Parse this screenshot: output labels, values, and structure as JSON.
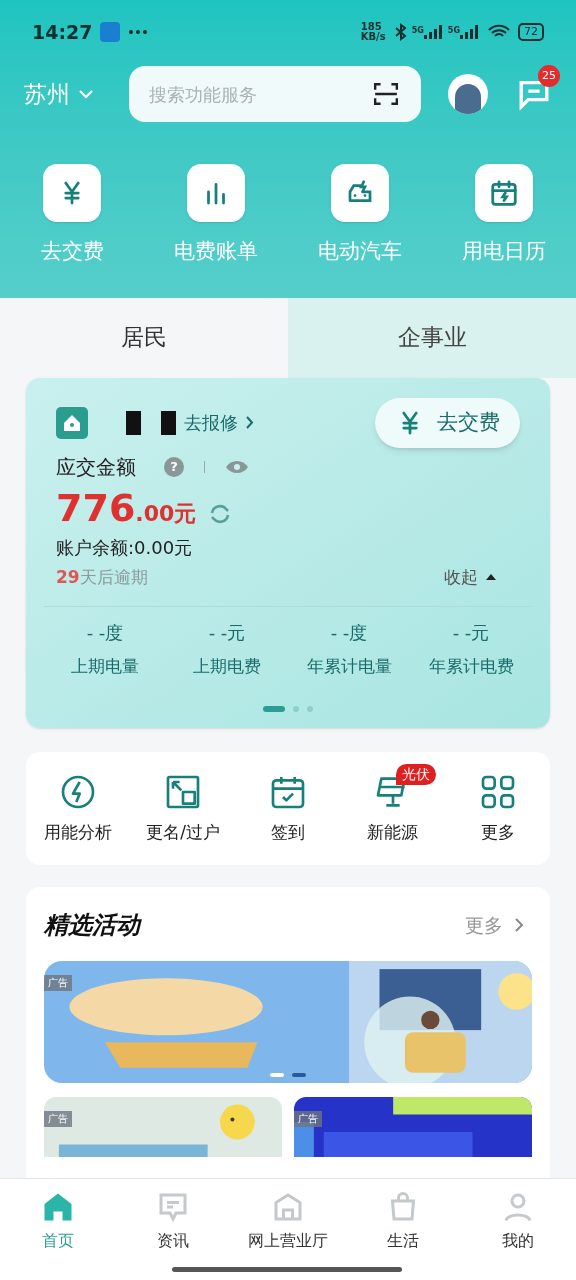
{
  "status_bar": {
    "time": "14:27",
    "speed": "185\nKB/s",
    "battery": "72",
    "network": [
      "5G",
      "5G"
    ]
  },
  "header": {
    "city": "苏州",
    "search": {
      "placeholder": "搜索功能服务"
    },
    "messages_badge": "25"
  },
  "quick_actions": [
    {
      "kind": "yuan",
      "label": "去交费"
    },
    {
      "kind": "bars",
      "label": "电费账单"
    },
    {
      "kind": "car",
      "label": "电动汽车"
    },
    {
      "kind": "calendar",
      "label": "用电日历"
    }
  ],
  "tabs": [
    {
      "label": "居民",
      "selected": true
    },
    {
      "label": "企事业",
      "selected": false
    }
  ],
  "account": {
    "repair_link": "去报修",
    "pay_button": "去交费",
    "amount_label": "应交金额",
    "help": "?",
    "amount_integer": "776",
    "amount_decimal": ".00元",
    "balance": "账户余额:0.00元",
    "due_days": "29",
    "due_text": "天后逾期",
    "collapse": "收起",
    "stats": [
      {
        "value": "- -度",
        "label": "上期电量"
      },
      {
        "value": "- -元",
        "label": "上期电费"
      },
      {
        "value": "- -度",
        "label": "年累计电量"
      },
      {
        "value": "- -元",
        "label": "年累计电费"
      }
    ],
    "pages": [
      {
        "selected": true
      },
      {
        "selected": false
      },
      {
        "selected": false
      }
    ]
  },
  "services": [
    {
      "kind": "bolt",
      "label": "用能分析"
    },
    {
      "kind": "transfer",
      "label": "更名/过户"
    },
    {
      "kind": "checkin",
      "label": "签到"
    },
    {
      "kind": "solar",
      "label": "新能源",
      "badge": "光伏"
    },
    {
      "kind": "grid",
      "label": "更多"
    }
  ],
  "activities": {
    "title": "精选活动",
    "more": "更多",
    "banner": {
      "tag": "广告",
      "pages": [
        {
          "selected": false
        },
        {
          "selected": true
        }
      ]
    },
    "cards": [
      {
        "tag": "广告"
      },
      {
        "tag": "广告"
      }
    ]
  },
  "bottom_nav": [
    {
      "kind": "home",
      "label": "首页",
      "selected": true
    },
    {
      "kind": "news",
      "label": "资讯",
      "selected": false
    },
    {
      "kind": "hall",
      "label": "网上营业厅",
      "selected": false
    },
    {
      "kind": "life",
      "label": "生活",
      "selected": false
    },
    {
      "kind": "me",
      "label": "我的",
      "selected": false
    }
  ]
}
